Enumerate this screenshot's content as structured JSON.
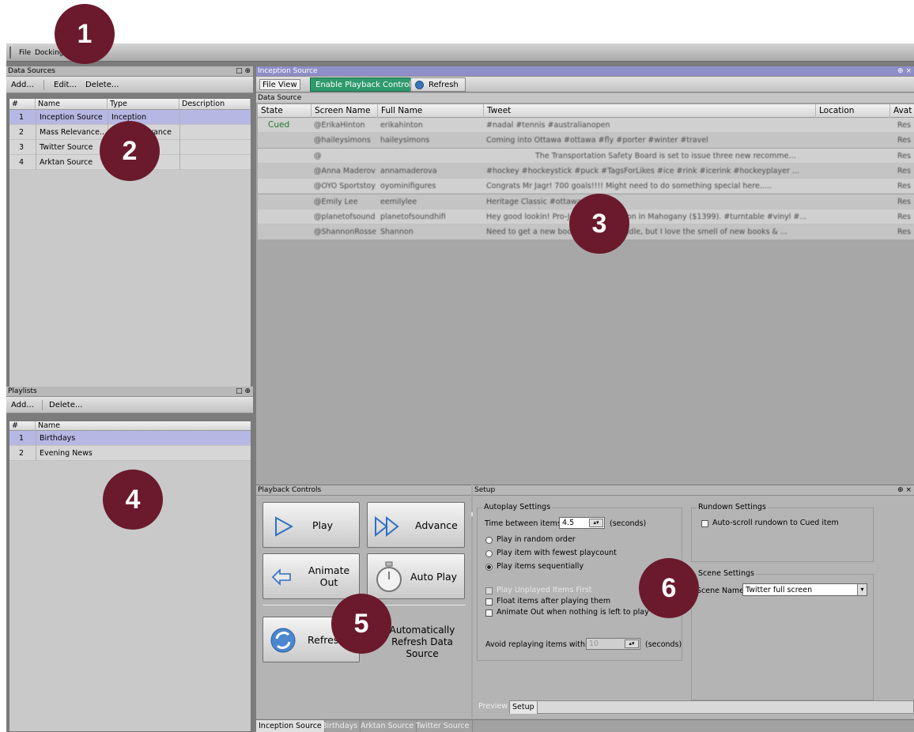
{
  "menu": {
    "items": [
      "File",
      "Docking"
    ]
  },
  "data_sources": {
    "title": "Data Sources",
    "toolbar": {
      "add": "Add...",
      "edit": "Edit...",
      "delete": "Delete..."
    },
    "columns": [
      "#",
      "Name",
      "Type",
      "Description"
    ],
    "rows": [
      {
        "num": "1",
        "name": "Inception Source",
        "type": "Inception",
        "description": ""
      },
      {
        "num": "2",
        "name": "Mass Relevance...",
        "type": "Mass Relevance",
        "description": ""
      },
      {
        "num": "3",
        "name": "Twitter Source",
        "type": "",
        "description": ""
      },
      {
        "num": "4",
        "name": "Arktan Source",
        "type": "",
        "description": ""
      }
    ]
  },
  "playlists": {
    "title": "Playlists",
    "toolbar": {
      "add": "Add...",
      "delete": "Delete..."
    },
    "columns": [
      "#",
      "Name"
    ],
    "rows": [
      {
        "num": "1",
        "name": "Birthdays"
      },
      {
        "num": "2",
        "name": "Evening News"
      }
    ]
  },
  "inception": {
    "title": "Inception Source",
    "toolbar": {
      "file_view": "File View",
      "enable_playback": "Enable Playback Controls",
      "refresh": "Refresh"
    },
    "data_source_label": "Data Source",
    "columns": [
      "State",
      "Screen Name",
      "Full Name",
      "Tweet",
      "Location",
      "Avat"
    ],
    "rows": [
      {
        "state": "Cued",
        "screen_name": "@ErikaHinton",
        "full_name": "erikahinton",
        "tweet": "#nadal #tennis #australianopen",
        "location": "",
        "avatar": "Res"
      },
      {
        "state": "",
        "screen_name": "@haileysimons",
        "full_name": "haileysimons",
        "tweet": "Coming into Ottawa #ottawa #fly #porter #winter #travel",
        "location": "",
        "avatar": "Res"
      },
      {
        "state": "",
        "screen_name": "@",
        "full_name": "",
        "tweet": "The Transportation Safety Board is set to issue three new recomme...",
        "location": "",
        "avatar": "Res"
      },
      {
        "state": "",
        "screen_name": "@Anna Maderov",
        "full_name": "annamaderova",
        "tweet": "#hockey #hockeystick #puck #TagsForLikes #ice #rink #icerink #hockeyplayer ...",
        "location": "",
        "avatar": "Res"
      },
      {
        "state": "",
        "screen_name": "@OYO Sportstoy",
        "full_name": "oyominifigures",
        "tweet": "Congrats Mr Jagr! 700 goals!!!! Might need to do something special here.....",
        "location": "",
        "avatar": "Res"
      },
      {
        "state": "",
        "screen_name": "@Emily Lee",
        "full_name": "eemilylee",
        "tweet": "Heritage Classic #ottawa",
        "location": "",
        "avatar": "Res"
      },
      {
        "state": "",
        "screen_name": "@planetofsound",
        "full_name": "planetofsoundhifi",
        "tweet": "Hey good lookin! Pro-Ject Debut Carbon in Mahogany ($1399). #turntable #vinyl #...",
        "location": "",
        "avatar": "Res"
      },
      {
        "state": "",
        "screen_name": "@ShannonRossell",
        "full_name": "Shannon",
        "tweet": "Need to get a new book. I love my kindle, but I love the smell of new books & ...",
        "location": "",
        "avatar": "Res"
      }
    ]
  },
  "playback": {
    "title": "Playback Controls",
    "play": "Play",
    "advance": "Advance",
    "animate_out": "Animate\nOut",
    "auto_play": "Auto Play",
    "refresh": "Refresh",
    "auto_refresh": "Automatically\nRefresh Data\nSource"
  },
  "setup": {
    "title": "Setup",
    "autoplay": {
      "legend": "Autoplay Settings",
      "time_label": "Time between items:",
      "time_value": "4.5",
      "seconds": "(seconds)",
      "radios": [
        "Play in random order",
        "Play item with fewest playcount",
        "Play items sequentially"
      ],
      "selected_radio": 2,
      "checks": [
        "Play Unplayed Items First",
        "Float items after playing them",
        "Animate Out when nothing is left to play"
      ],
      "avoid_label": "Avoid replaying items within:",
      "avoid_value": "10",
      "avoid_seconds": "(seconds)"
    },
    "rundown": {
      "legend": "Rundown Settings",
      "auto_scroll": "Auto-scroll rundown to Cued item"
    },
    "scene": {
      "legend": "Scene Settings",
      "label": "Scene Name:",
      "value": "Twitter full screen"
    },
    "tabs": [
      "Preview",
      "Setup"
    ]
  },
  "bottom_tabs": [
    "Inception Source",
    "Birthdays",
    "Arktan Source",
    "Twitter Source"
  ],
  "badges": [
    "1",
    "2",
    "3",
    "4",
    "5",
    "6"
  ],
  "colors": {
    "accent_green": "#2f9a6c",
    "selection": "#bdbde6",
    "badge": "#6a1a2c",
    "cued_text": "#1f7a28"
  }
}
